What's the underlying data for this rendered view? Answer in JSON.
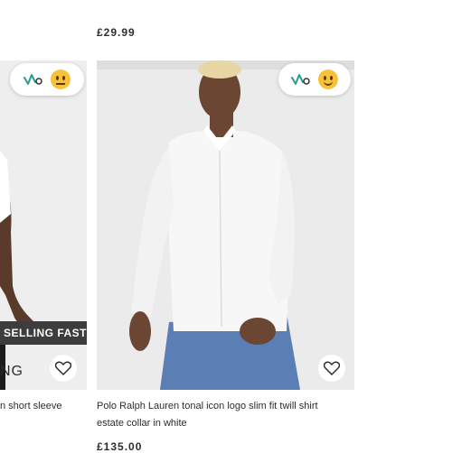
{
  "top_price": "£29.99",
  "left_card": {
    "badge": "SELLING FAST",
    "brand_fragment": "NG",
    "title_fragment": "n short sleeve",
    "rating_emoji": "neutral-face-icon"
  },
  "right_card": {
    "title_line1": "Polo Ralph Lauren tonal icon logo slim fit twill shirt",
    "title_line2": "estate collar in white",
    "price": "£135.00",
    "rating_emoji": "smiling-face-icon"
  },
  "colors": {
    "badge_bg": "#3d3d3d",
    "accent_logo": "#2a9d8f"
  }
}
